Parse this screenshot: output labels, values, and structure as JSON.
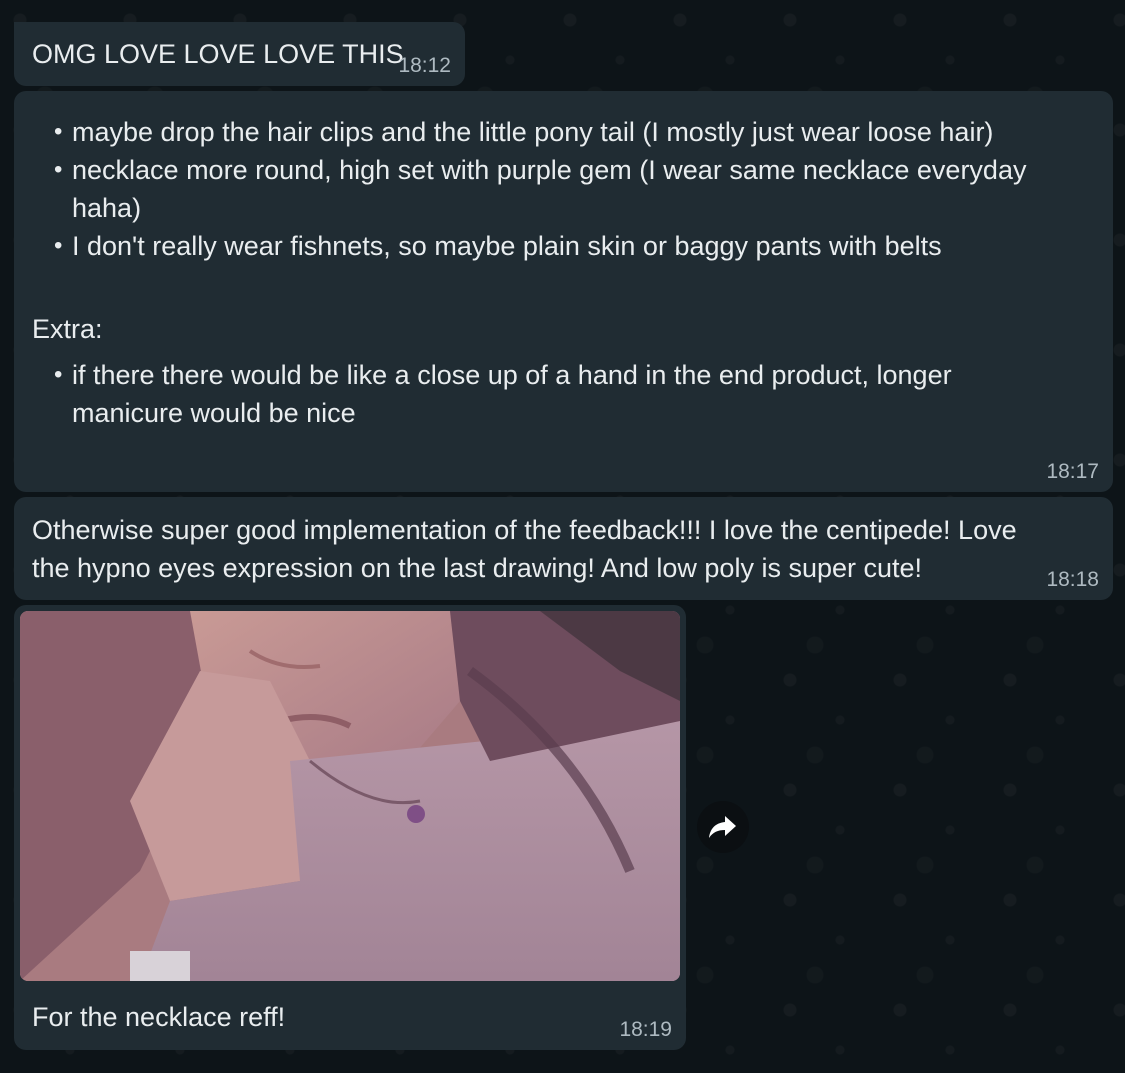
{
  "messages": [
    {
      "text": "OMG LOVE LOVE LOVE THIS",
      "time": "18:12"
    },
    {
      "bullets": [
        "maybe drop the hair clips and the little pony tail (I mostly just wear loose hair)",
        "necklace more round, high set with purple gem (I wear same necklace everyday haha)",
        "I don't really wear fishnets, so maybe plain skin or baggy pants with belts"
      ],
      "extra_heading": "Extra:",
      "extra_bullets": [
        "if there there would be like a close up of a hand in the end product, longer manicure would be nice"
      ],
      "time": "18:17"
    },
    {
      "text": "Otherwise super good implementation of the feedback!!! I love the centipede! Love the hypno eyes expression on the last drawing! And low poly is super cute!",
      "time": "18:18"
    },
    {
      "caption": "For the necklace reff!",
      "time": "18:19"
    }
  ],
  "icons": {
    "forward": "forward-arrow-icon"
  },
  "colors": {
    "bubble": "#202c33",
    "background": "#0d1418",
    "timestamp": "#aebac1",
    "text": "#e9edef"
  }
}
